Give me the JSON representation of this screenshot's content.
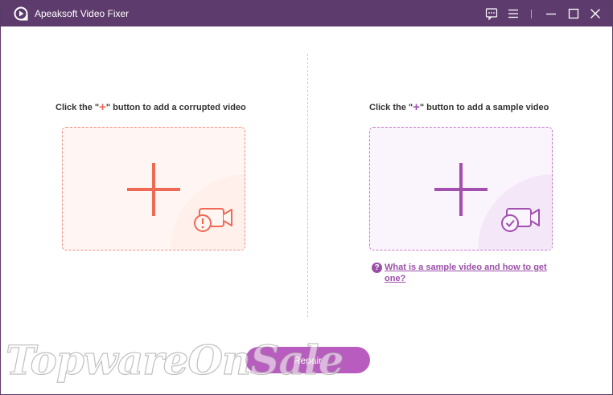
{
  "window": {
    "title": "Apeaksoft Video Fixer",
    "colors": {
      "titlebar": "#5d3b6c",
      "accent": "#b85cbf",
      "left_accent": "#ee6a55",
      "right_accent": "#a24fb0"
    }
  },
  "titlebar_buttons": [
    {
      "name": "feedback-icon"
    },
    {
      "name": "menu-icon"
    },
    {
      "name": "minimize-icon"
    },
    {
      "name": "maximize-icon"
    },
    {
      "name": "close-icon"
    }
  ],
  "left_panel": {
    "instruction_prefix": "Click the \"",
    "plus_symbol": "+",
    "instruction_suffix": "\" button to add a corrupted video",
    "icons": [
      "plus-icon",
      "corrupted-video-camera-icon"
    ]
  },
  "right_panel": {
    "instruction_prefix": "Click the \"",
    "plus_symbol": "+",
    "instruction_suffix": "\" button to add a sample video",
    "icons": [
      "plus-icon",
      "sample-video-camera-icon"
    ],
    "help_icon_glyph": "?",
    "help_link": "What is a sample video and how to get one?"
  },
  "repair_button": {
    "label": "Repair"
  },
  "watermark": "TopwareOnSale"
}
